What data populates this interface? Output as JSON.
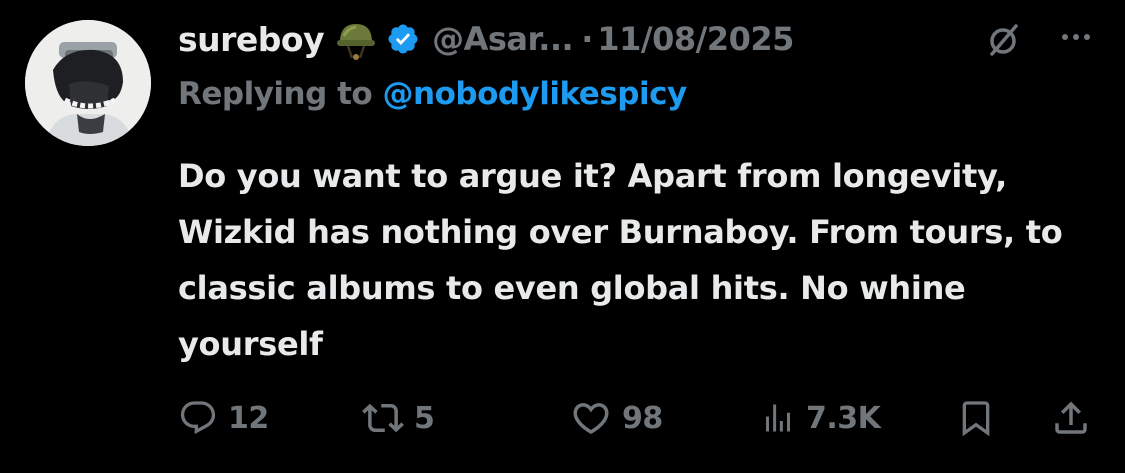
{
  "tweet": {
    "display_name": "sureboy",
    "name_emoji_icon": "military-helmet-icon",
    "verified_icon": "verified-badge-icon",
    "handle": "@Asar...",
    "separator": "·",
    "date": "11/08/2025",
    "replying_prefix": "Replying to",
    "replying_to": "@nobodylikespicy",
    "text": "Do you want to argue it? Apart from longevity, Wizkid has nothing over Burnaboy. From tours, to classic albums to even global hits. No whine yourself"
  },
  "actions": {
    "replies": "12",
    "reposts": "5",
    "likes": "98",
    "views": "7.3K"
  },
  "colors": {
    "background": "#000000",
    "text": "#e7e9ea",
    "muted": "#71767b",
    "accent": "#1d9bf0"
  }
}
